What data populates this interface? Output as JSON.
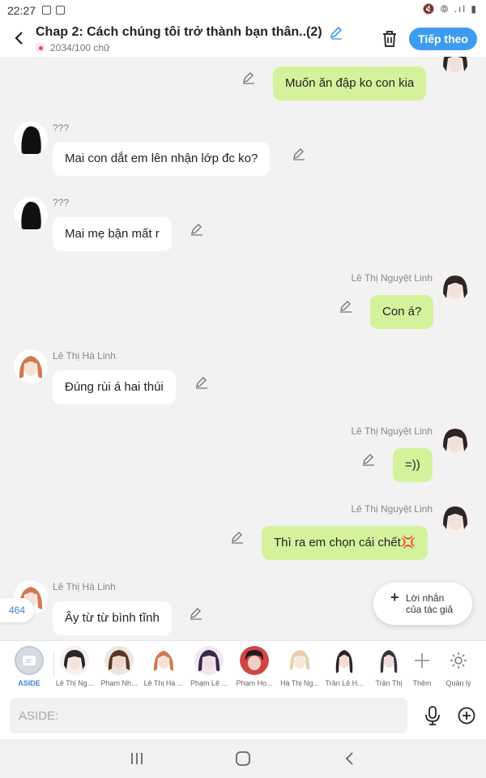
{
  "status": {
    "time": "22:27",
    "indicators": "🔇 ⦾ .ıl ▮"
  },
  "header": {
    "title": "Chap 2: Cách chúng tôi trở thành bạn thân..(2)",
    "word_count": "2034/100 chữ",
    "next_label": "Tiếp theo"
  },
  "messages": [
    {
      "text": "Muốn ăn đập ko con kia",
      "name": ""
    },
    {
      "name": "???",
      "text": "Mai con dắt em lên nhận lớp đc ko?"
    },
    {
      "name": "???",
      "text": "Mai mẹ bận mất r"
    },
    {
      "name": "Lê Thị Nguyệt Linh",
      "text": "Con á?"
    },
    {
      "name": "Lê Thị Hà Linh",
      "text": "Đúng rùi á hai thúi"
    },
    {
      "name": "Lê Thị Nguyệt Linh",
      "text": "=))"
    },
    {
      "name": "Lê Thị Nguyệt Linh",
      "text": "Thì ra em chọn cái chết💢"
    },
    {
      "name": "Lê Thị Hà Linh",
      "text": "Ây từ từ bình tĩnh"
    }
  ],
  "message_count": "464",
  "author_note": {
    "line1": "Lời nhắn",
    "line2": "của tác giả"
  },
  "characters": [
    {
      "label": "ASIDE"
    },
    {
      "label": "Lê Thị Ng..."
    },
    {
      "label": "Phạm Nh..."
    },
    {
      "label": "Lê Thị Hà ..."
    },
    {
      "label": "Phạm Lê ..."
    },
    {
      "label": "Phạm Ho..."
    },
    {
      "label": "Hà Thị Ng..."
    },
    {
      "label": "Trần Lê H..."
    },
    {
      "label": "Trần Thị"
    },
    {
      "label": "Thêm"
    },
    {
      "label": "Quản lý"
    }
  ],
  "input": {
    "placeholder": "ASIDE:"
  },
  "colors": {
    "accent": "#3d9cf0",
    "right_bubble": "#d4f29c",
    "left_bubble": "#ffffff"
  }
}
